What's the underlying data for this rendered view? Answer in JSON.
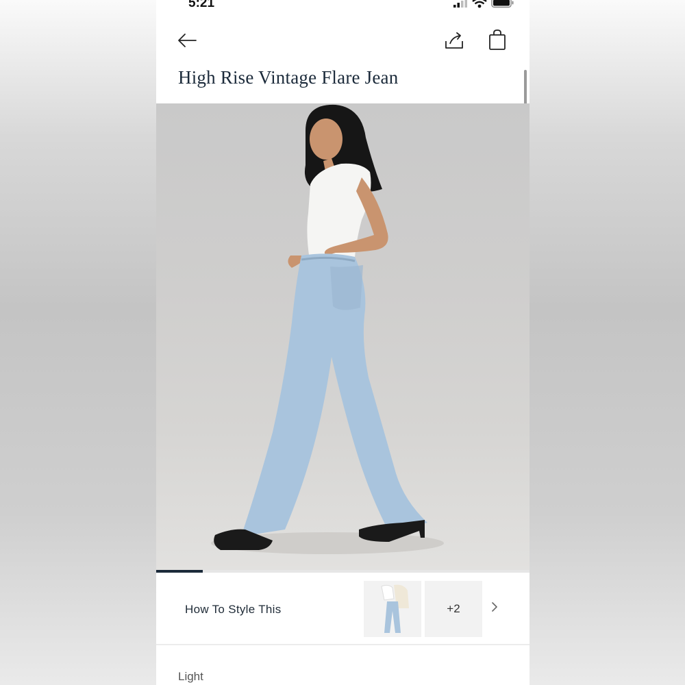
{
  "status_bar": {
    "time": "5:21"
  },
  "product": {
    "title": "High Rise Vintage Flare Jean"
  },
  "carousel": {
    "progress": 0.125
  },
  "style_section": {
    "label": "How To Style This",
    "more_count": "+2"
  },
  "color": {
    "label": "Light"
  },
  "icons": {
    "back": "arrow-left-icon",
    "share": "share-icon",
    "bag": "shopping-bag-icon",
    "chevron": "chevron-right-icon",
    "signal": "signal-icon",
    "wifi": "wifi-icon",
    "battery": "battery-icon"
  },
  "colors": {
    "title": "#1b2a3a",
    "accent": "#1b2a3a",
    "jeans": "#a9c4dd"
  }
}
